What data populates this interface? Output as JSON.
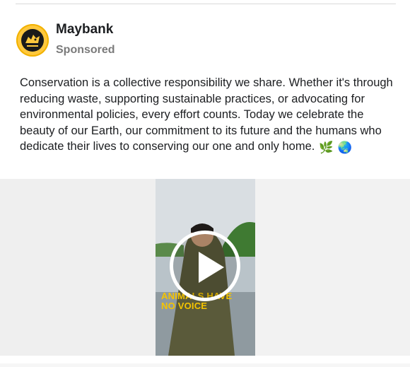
{
  "post": {
    "page_name": "Maybank",
    "sponsored_label": "Sponsored",
    "text": "Conservation is a collective responsibility we share. Whether it's through reducing waste, supporting sustainable practices, or advocating for environmental policies, every effort counts. Today we celebrate the beauty of our Earth, our commitment to its future and the humans who dedicate their lives to conserving our one and only home.",
    "emoji_1": "🌿",
    "emoji_2": "🌏"
  },
  "video": {
    "caption": "ANIMALS HAVE\nNO VOICE",
    "icon": "play-icon"
  },
  "colors": {
    "brand_yellow": "#ffc83d",
    "caption_yellow": "#f5c400"
  }
}
